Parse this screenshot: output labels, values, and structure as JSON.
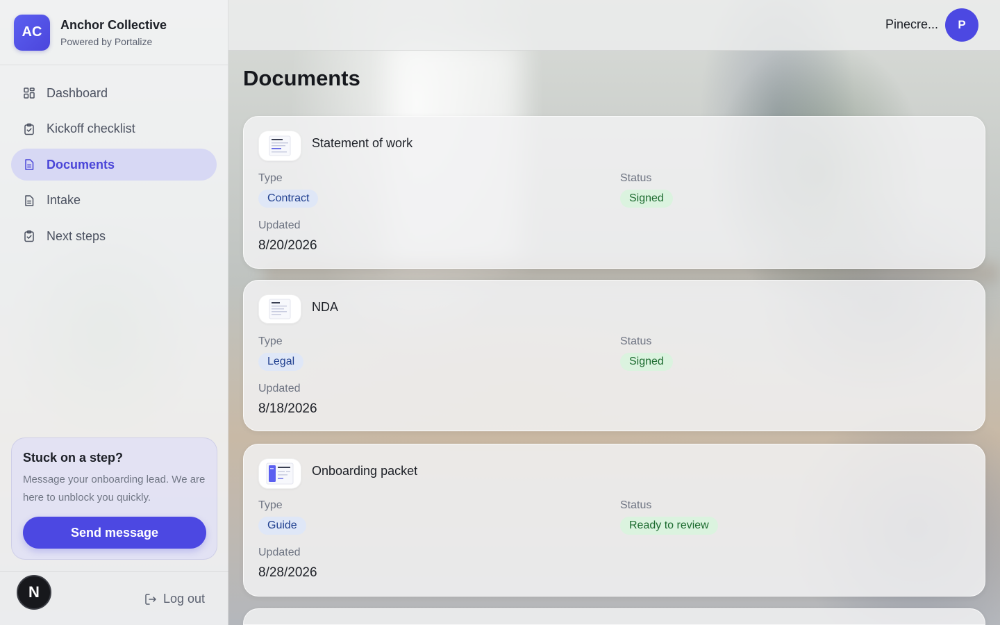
{
  "brand": {
    "initials": "AC",
    "name": "Anchor Collective",
    "powered_by": "Powered by Portalize"
  },
  "nav": {
    "items": [
      {
        "label": "Dashboard",
        "icon": "dashboard-grid-icon",
        "active": false
      },
      {
        "label": "Kickoff checklist",
        "icon": "clipboard-check-icon",
        "active": false
      },
      {
        "label": "Documents",
        "icon": "document-icon",
        "active": true
      },
      {
        "label": "Intake",
        "icon": "document-icon",
        "active": false
      },
      {
        "label": "Next steps",
        "icon": "clipboard-check-icon",
        "active": false
      }
    ]
  },
  "help": {
    "title": "Stuck on a step?",
    "text": "Message your onboarding lead. We are here to unblock you quickly.",
    "button_label": "Send message"
  },
  "footer": {
    "badge_letter": "N",
    "logout_label": "Log out"
  },
  "user": {
    "name": "Pinecre...",
    "avatar_initial": "P"
  },
  "page": {
    "title": "Documents"
  },
  "documents": [
    {
      "title": "Statement of work",
      "type_label": "Type",
      "type": "Contract",
      "status_label": "Status",
      "status": "Signed",
      "updated_label": "Updated",
      "updated": "8/20/2026",
      "thumbnail": "document-thumbnail-icon"
    },
    {
      "title": "NDA",
      "type_label": "Type",
      "type": "Legal",
      "status_label": "Status",
      "status": "Signed",
      "updated_label": "Updated",
      "updated": "8/18/2026",
      "thumbnail": "document-thumbnail-icon"
    },
    {
      "title": "Onboarding packet",
      "type_label": "Type",
      "type": "Guide",
      "status_label": "Status",
      "status": "Ready to review",
      "updated_label": "Updated",
      "updated": "8/28/2026",
      "thumbnail": "guide-thumbnail-icon"
    }
  ],
  "colors": {
    "accent": "#4c48e2",
    "type_badge_bg": "#dfe7f7",
    "type_badge_text": "#1f3f8f",
    "status_badge_bg": "#dbf3df",
    "status_badge_text": "#1b6a2e"
  }
}
